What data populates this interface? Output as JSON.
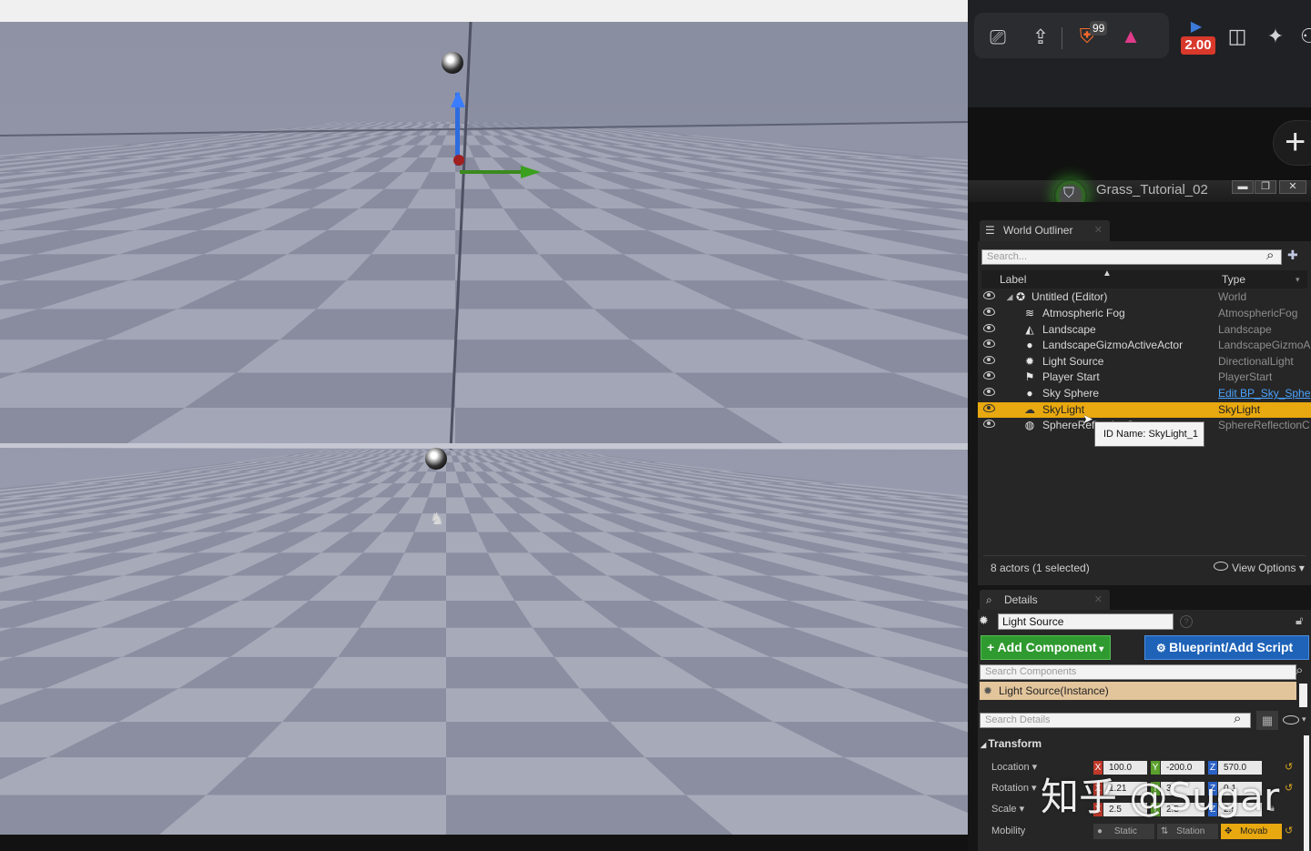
{
  "browser": {
    "brave_count": "99",
    "playback_speed": "2.00"
  },
  "ue_window": {
    "project_title": "Grass_Tutorial_02",
    "minimize": "▬",
    "maximize": "❐",
    "close": "✕"
  },
  "world_outliner": {
    "tab_title": "World Outliner",
    "search_placeholder": "Search...",
    "col_label": "Label",
    "col_type": "Type",
    "rows": [
      {
        "label": "Untitled (Editor)",
        "type": "World"
      },
      {
        "label": "Atmospheric Fog",
        "type": "AtmosphericFog"
      },
      {
        "label": "Landscape",
        "type": "Landscape"
      },
      {
        "label": "LandscapeGizmoActiveActor",
        "type": "LandscapeGizmoA"
      },
      {
        "label": "Light Source",
        "type": "DirectionalLight"
      },
      {
        "label": "Player Start",
        "type": "PlayerStart"
      },
      {
        "label": "Sky Sphere",
        "type": "Edit BP_Sky_Sphe"
      },
      {
        "label": "SkyLight",
        "type": "SkyLight"
      },
      {
        "label": "SphereReflectionCapture",
        "type": "SphereReflectionC"
      }
    ],
    "tooltip": "ID Name: SkyLight_1",
    "footer": "8 actors (1 selected)",
    "view_options": "View Options"
  },
  "details": {
    "tab_title": "Details",
    "actor_name": "Light Source",
    "add_component": "+ Add Component",
    "blueprint_add_script": "Blueprint/Add Script",
    "search_components_placeholder": "Search Components",
    "component_instance": "Light Source(Instance)",
    "search_details_placeholder": "Search Details",
    "transform_header": "Transform",
    "location_label": "Location",
    "rotation_label": "Rotation",
    "scale_label": "Scale",
    "mobility_label": "Mobility",
    "location": {
      "x": "100.0",
      "y": "-200.0",
      "z": "570.0"
    },
    "rotation": {
      "x": "1.21",
      "y": "3",
      "z": "0.1"
    },
    "scale": {
      "x": "2.5",
      "y": "2.5",
      "z": "2.5"
    },
    "mobility_options": [
      "Static",
      "Station",
      "Movab"
    ]
  },
  "watermark": "知乎 @Sugar",
  "colors": {
    "selected_row": "#e8a80f",
    "add_component": "#2f9a2f",
    "blueprint_button": "#1f63b8",
    "speed_badge": "#d8392b"
  }
}
